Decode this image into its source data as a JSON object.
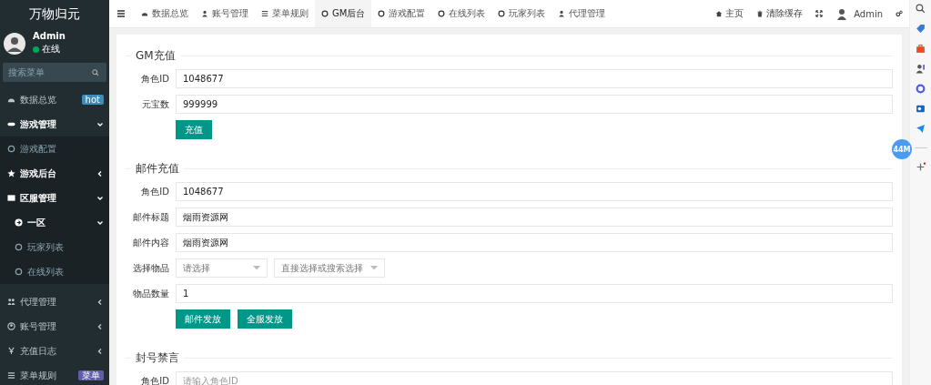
{
  "sidebar": {
    "title": "万物归元",
    "user": {
      "name": "Admin",
      "status": "在线"
    },
    "search": {
      "placeholder": "搜索菜单"
    },
    "items": [
      {
        "label": "数据总览",
        "badge": {
          "text": "hot",
          "color": "#3c8dbc"
        }
      },
      {
        "label": "游戏管理",
        "expanded": true,
        "children": [
          {
            "label": "游戏配置"
          },
          {
            "label": "游戏后台",
            "expanded": false
          },
          {
            "label": "区服管理",
            "expanded": true,
            "children": [
              {
                "label": "一区",
                "expanded": true,
                "children": [
                  {
                    "label": "玩家列表"
                  },
                  {
                    "label": "在线列表"
                  }
                ]
              }
            ]
          }
        ]
      },
      {
        "label": "代理管理",
        "expanded": false
      },
      {
        "label": "账号管理",
        "expanded": false
      },
      {
        "label": "充值日志",
        "expanded": false
      },
      {
        "label": "菜单规则",
        "badge": {
          "text": "菜单",
          "color": "#605ca8"
        }
      }
    ]
  },
  "topbar": {
    "tabs": [
      {
        "label": "数据总览",
        "selected": false
      },
      {
        "label": "账号管理",
        "selected": false
      },
      {
        "label": "菜单规则",
        "selected": false
      },
      {
        "label": "GM后台",
        "selected": true
      },
      {
        "label": "游戏配置",
        "selected": false
      },
      {
        "label": "在线列表",
        "selected": false
      },
      {
        "label": "玩家列表",
        "selected": false
      },
      {
        "label": "代理管理",
        "selected": false
      }
    ],
    "home": "主页",
    "clear_cache": "清除缓存",
    "user": "Admin"
  },
  "sections": [
    {
      "title": "GM充值",
      "fields": [
        {
          "kind": "input",
          "label": "角色ID",
          "value": "1048677"
        },
        {
          "kind": "input",
          "label": "元宝数",
          "value": "999999"
        }
      ],
      "buttons": [
        "充值"
      ]
    },
    {
      "title": "邮件充值",
      "fields": [
        {
          "kind": "input",
          "label": "角色ID",
          "value": "1048677"
        },
        {
          "kind": "input",
          "label": "邮件标题",
          "value": "烟雨资源网"
        },
        {
          "kind": "input",
          "label": "邮件内容",
          "value": "烟雨资源网"
        },
        {
          "kind": "selects",
          "label": "选择物品",
          "placeholders": [
            "请选择",
            "直接选择或搜索选择"
          ]
        },
        {
          "kind": "input",
          "label": "物品数量",
          "value": "1"
        }
      ],
      "buttons": [
        "邮件发放",
        "全服发放"
      ]
    },
    {
      "title": "封号禁言",
      "fields": [
        {
          "kind": "input",
          "label": "角色ID",
          "placeholder": "请输入角色ID"
        }
      ]
    }
  ],
  "browser_sidebar": {
    "badge": "44M"
  }
}
